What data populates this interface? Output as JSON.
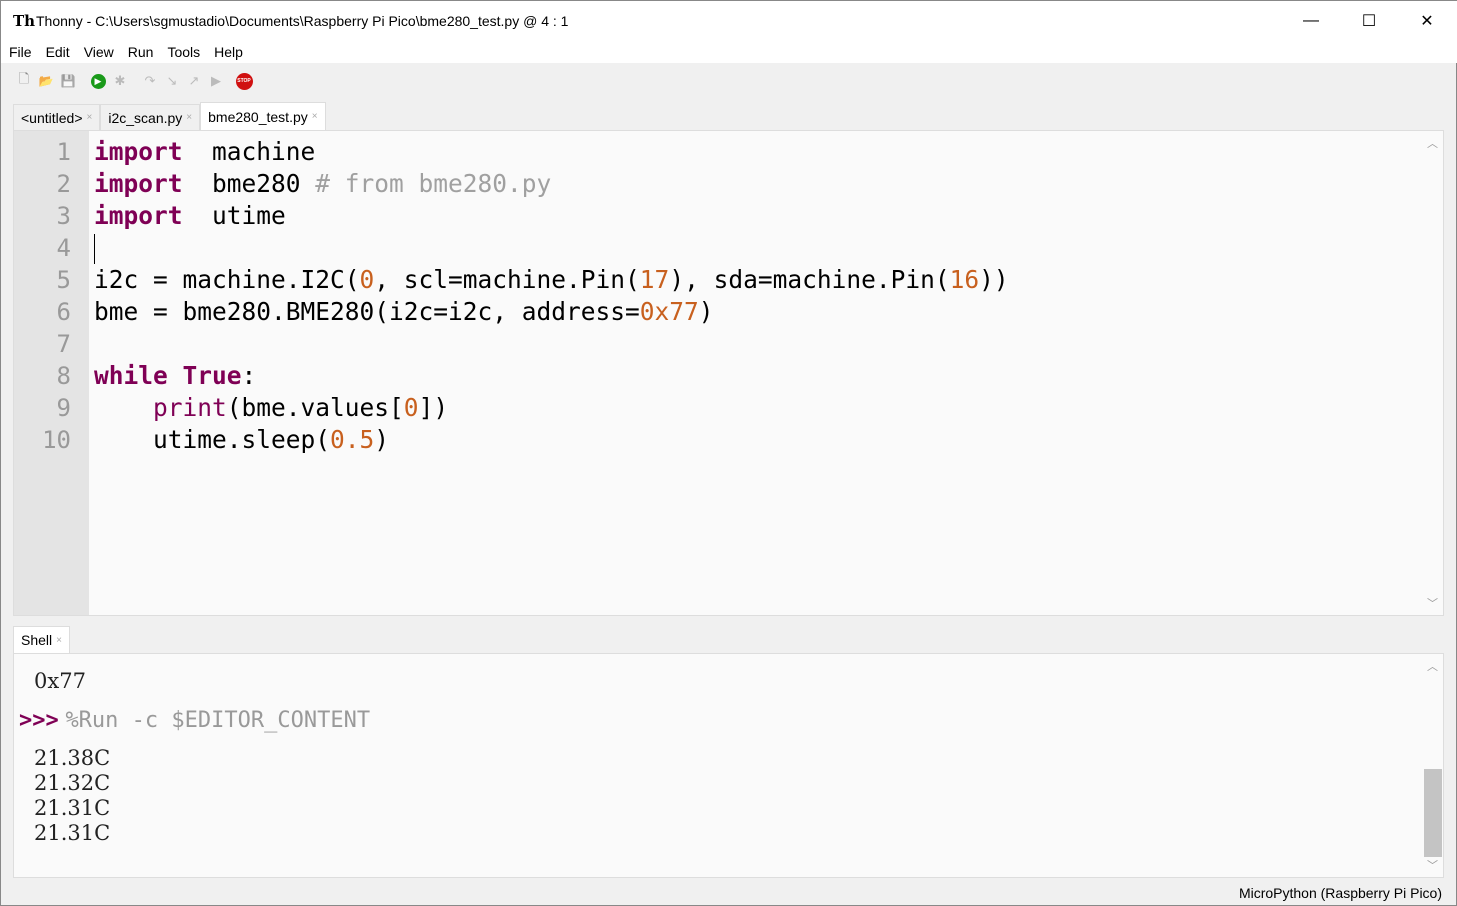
{
  "window": {
    "logo": "Th",
    "title": "Thonny  -  C:\\Users\\sgmustadio\\Documents\\Raspberry Pi Pico\\bme280_test.py  @  4 : 1",
    "minimize": "—",
    "maximize": "☐",
    "close": "✕"
  },
  "menu": [
    "File",
    "Edit",
    "View",
    "Run",
    "Tools",
    "Help"
  ],
  "toolbar": [
    {
      "icon": "new-file-icon",
      "glyph": "🗋"
    },
    {
      "icon": "open-folder-icon",
      "glyph": "📂"
    },
    {
      "icon": "save-icon",
      "glyph": "💾"
    },
    {
      "icon": "run-icon",
      "glyph": "▶"
    },
    {
      "icon": "debug-icon",
      "glyph": "✱"
    },
    {
      "icon": "step-over-icon",
      "glyph": "↷"
    },
    {
      "icon": "step-into-icon",
      "glyph": "↘"
    },
    {
      "icon": "step-out-icon",
      "glyph": "↗"
    },
    {
      "icon": "resume-icon",
      "glyph": "▶"
    },
    {
      "icon": "stop-icon",
      "glyph": "STOP"
    }
  ],
  "tabs": [
    {
      "label": "<untitled>",
      "close": "×"
    },
    {
      "label": "i2c_scan.py",
      "close": "×"
    },
    {
      "label": "bme280_test.py",
      "close": "×",
      "active": true
    }
  ],
  "editor": {
    "lines": [
      [
        [
          "kw",
          "import"
        ],
        [
          "",
          "  machine"
        ]
      ],
      [
        [
          "kw",
          "import"
        ],
        [
          "",
          "  bme280 "
        ],
        [
          "cm",
          "# from bme280.py"
        ]
      ],
      [
        [
          "kw",
          "import"
        ],
        [
          "",
          "  utime"
        ]
      ],
      [],
      [
        [
          "",
          "i2c = machine.I2C("
        ],
        [
          "num",
          "0"
        ],
        [
          "",
          ", scl=machine.Pin("
        ],
        [
          "num",
          "17"
        ],
        [
          "",
          "), sda=machine.Pin("
        ],
        [
          "num",
          "16"
        ],
        [
          "",
          "))"
        ]
      ],
      [
        [
          "",
          "bme = bme280.BME280(i2c=i2c, address="
        ],
        [
          "num",
          "0x77"
        ],
        [
          "",
          ")"
        ]
      ],
      [],
      [
        [
          "kw",
          "while"
        ],
        [
          "",
          " "
        ],
        [
          "kw",
          "True"
        ],
        [
          "",
          ":"
        ]
      ],
      [
        [
          "",
          "    "
        ],
        [
          "bi",
          "print"
        ],
        [
          "",
          "(bme.values["
        ],
        [
          "num",
          "0"
        ],
        [
          "",
          "])"
        ]
      ],
      [
        [
          "",
          "    utime.sleep("
        ],
        [
          "num",
          "0.5"
        ],
        [
          "",
          ")"
        ]
      ]
    ],
    "line_numbers": [
      "1",
      "2",
      "3",
      "4",
      "5",
      "6",
      "7",
      "8",
      "9",
      "10"
    ]
  },
  "shell": {
    "tab": "Shell",
    "close": "×",
    "output_prev": "0x77",
    "prompt": ">>>",
    "command": "%Run -c $EDITOR_CONTENT",
    "output": [
      "21.38C",
      "21.32C",
      "21.31C",
      "21.31C"
    ]
  },
  "status": "MicroPython (Raspberry Pi Pico)",
  "colors": {
    "keyword": "#7f0055",
    "number": "#c8601e",
    "comment": "#a0a0a0",
    "stop": "#d01010",
    "run": "#1a9a1a"
  }
}
